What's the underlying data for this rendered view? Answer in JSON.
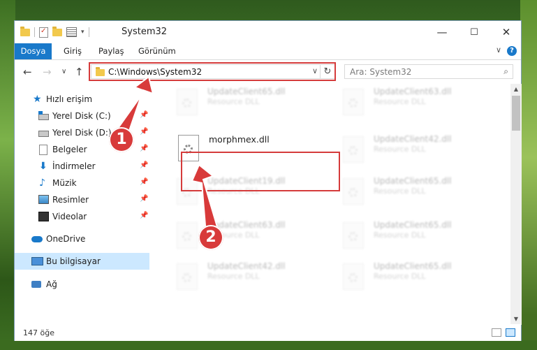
{
  "window": {
    "title": "System32",
    "minimize": "—",
    "maximize": "☐",
    "close": "✕"
  },
  "ribbon": {
    "tabs": [
      "Dosya",
      "Giriş",
      "Paylaş",
      "Görünüm"
    ],
    "collapse": "∨",
    "help": "?"
  },
  "nav": {
    "back": "←",
    "forward": "→",
    "recent": "∨",
    "up": "↑",
    "address": "C:\\Windows\\System32",
    "address_drop": "∨",
    "refresh": "↻",
    "search_placeholder": "Ara: System32",
    "search_icon": "⌕"
  },
  "sidebar": {
    "items": [
      {
        "label": "Hızlı erişim",
        "icon": "star-icon"
      },
      {
        "label": "Yerel Disk (C:)",
        "icon": "drive-c-icon"
      },
      {
        "label": "Yerel Disk (D:)",
        "icon": "drive-d-icon"
      },
      {
        "label": "Belgeler",
        "icon": "documents-icon"
      },
      {
        "label": "İndirmeler",
        "icon": "downloads-icon"
      },
      {
        "label": "Müzik",
        "icon": "music-icon"
      },
      {
        "label": "Resimler",
        "icon": "pictures-icon"
      },
      {
        "label": "Videolar",
        "icon": "videos-icon"
      },
      {
        "label": "OneDrive",
        "icon": "cloud-icon"
      },
      {
        "label": "Bu bilgisayar",
        "icon": "computer-icon"
      },
      {
        "label": "Ağ",
        "icon": "network-icon"
      }
    ],
    "pin": "📌"
  },
  "files": {
    "focus": {
      "name": "morphmex.dll"
    },
    "blurred": [
      {
        "name": "UpdateClient65.dll",
        "type": "Resource DLL"
      },
      {
        "name": "UpdateClient63.dll",
        "type": "Resource DLL"
      },
      {
        "name": "UpdateClient42.dll",
        "type": "Resource DLL"
      },
      {
        "name": "UpdateClient19.dll",
        "type": "Resource DLL"
      },
      {
        "name": "UpdateClient65.dll",
        "type": "Resource DLL"
      },
      {
        "name": "UpdateClient63.dll",
        "type": "Resource DLL"
      },
      {
        "name": "UpdateClient65.dll",
        "type": "Resource DLL"
      },
      {
        "name": "UpdateClient42.dll",
        "type": "Resource DLL"
      },
      {
        "name": "UpdateClient65.dll",
        "type": "Resource DLL"
      }
    ]
  },
  "status": {
    "count": "147 öğe"
  },
  "markers": {
    "one": "1",
    "two": "2"
  },
  "colors": {
    "accent": "#1979ca",
    "highlight": "#d53b3b",
    "selected": "#cce8ff"
  }
}
